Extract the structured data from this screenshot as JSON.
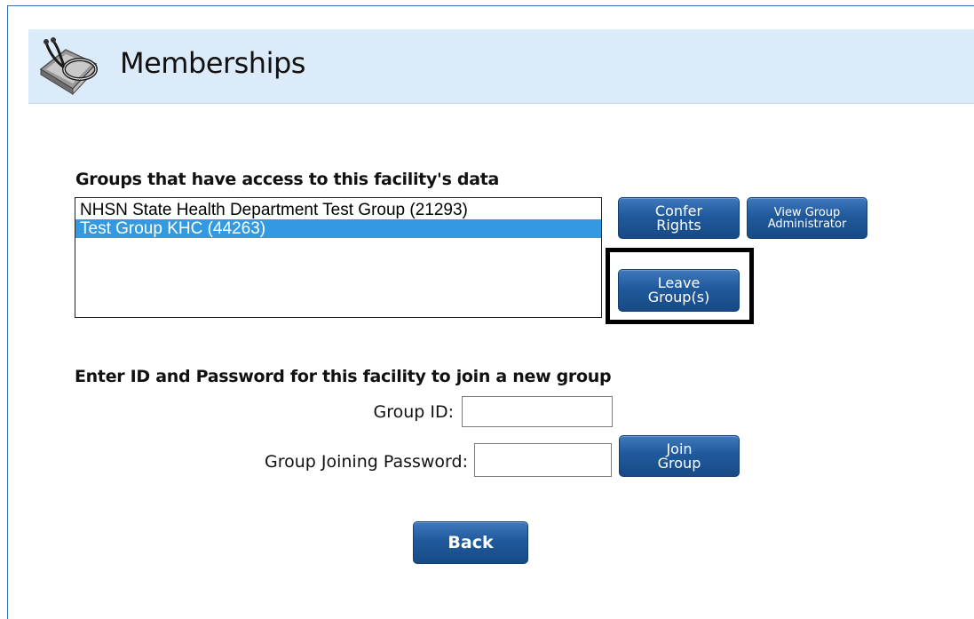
{
  "page": {
    "title": "Memberships",
    "icon": "stethoscope-book-icon"
  },
  "groups_section": {
    "heading": "Groups that have access to this facility's data",
    "items": [
      {
        "label": "NHSN State Health Department Test Group (21293)",
        "selected": false
      },
      {
        "label": "Test Group KHC (44263)",
        "selected": true
      }
    ]
  },
  "buttons": {
    "confer_rights": [
      "Confer",
      "Rights"
    ],
    "view_group_admin": [
      "View Group",
      "Administrator"
    ],
    "leave_groups": [
      "Leave",
      "Group(s)"
    ],
    "join_group": [
      "Join",
      "Group"
    ],
    "back": "Back"
  },
  "join_section": {
    "heading": "Enter ID and Password for this facility to join a new group",
    "group_id_label": "Group ID:",
    "group_id_value": "",
    "password_label": "Group Joining Password:",
    "password_value": ""
  },
  "colors": {
    "header_bg": "#dcebf9",
    "button": "#205a9c",
    "selection": "#3399e0"
  }
}
